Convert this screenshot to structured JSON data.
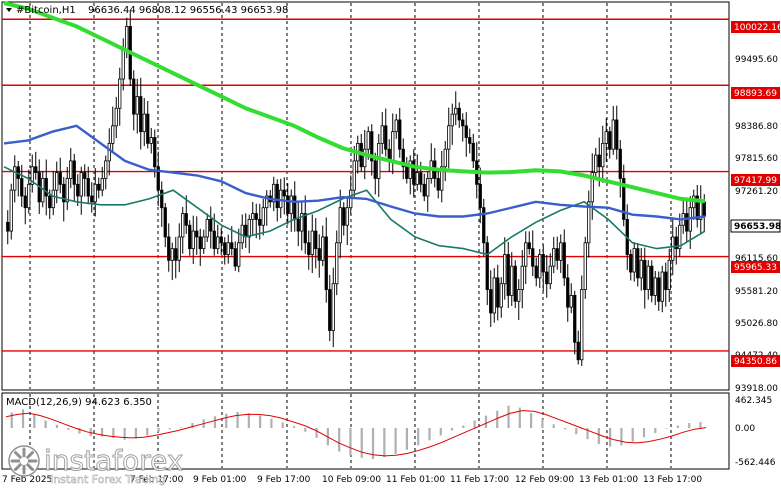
{
  "header": {
    "symbol": "#Bitcoin,H1",
    "ohlc": "96636.44 96808.12 96556.43 96653.98",
    "collapse_icon": "triangle-down-icon"
  },
  "price_axis": {
    "labels": [
      "99495.60",
      "98386.80",
      "97815.60",
      "97261.20",
      "96115.60",
      "95581.20",
      "95026.80",
      "94472.40",
      "93918.00"
    ]
  },
  "levels": [
    {
      "label": "100022.16",
      "color": "#e00000"
    },
    {
      "label": "98893.69",
      "color": "#e00000"
    },
    {
      "label": "97417.99",
      "color": "#e00000"
    },
    {
      "label": "95965.33",
      "color": "#e00000"
    },
    {
      "label": "94350.86",
      "color": "#e00000"
    }
  ],
  "current_price": {
    "label": "96653.98",
    "color": "#ffffff"
  },
  "macd": {
    "label": "MACD(12,26,9) 94.623 6.350",
    "axis_labels": [
      "462.345",
      "0.00",
      "-562.446"
    ]
  },
  "time_axis": {
    "labels": [
      "7 Feb 2025",
      "7 Feb 17:00",
      "9 Feb 01:00",
      "9 Feb 17:00",
      "10 Feb 09:00",
      "11 Feb 01:00",
      "11 Feb 17:00",
      "12 Feb 09:00",
      "13 Feb 01:00",
      "13 Feb 17:00"
    ]
  },
  "watermark": {
    "brand": "instaforex",
    "tagline": "Instant Forex Trading",
    "logo_icon": "instaforex-logo-icon"
  },
  "colors": {
    "bull": "#000000",
    "bear": "#000000",
    "ma_fast": "#1a7a6a",
    "ma_mid": "#3a5fcd",
    "ma_slow": "#33dd33",
    "level_line": "#e00000",
    "grid": "#000000"
  },
  "chart_data": {
    "type": "candlestick",
    "symbol": "#Bitcoin",
    "timeframe": "H1",
    "ylim": [
      93700,
      100300
    ],
    "horizontal_levels": [
      100022.16,
      98893.69,
      97417.99,
      95965.33,
      94350.86
    ],
    "candles_close": [
      96400,
      97100,
      97500,
      97300,
      97000,
      96800,
      97200,
      97500,
      97400,
      96900,
      97300,
      97000,
      96800,
      97100,
      97400,
      97200,
      96900,
      97300,
      97600,
      97200,
      97000,
      97400,
      97300,
      97000,
      96900,
      97200,
      97100,
      97300,
      97600,
      97900,
      98200,
      98500,
      99000,
      99500,
      99900,
      99000,
      98400,
      98700,
      98100,
      98400,
      97900,
      98000,
      97500,
      97100,
      96800,
      96300,
      95900,
      96100,
      95900,
      96300,
      96700,
      96500,
      96100,
      96400,
      96300,
      96100,
      96300,
      96600,
      96400,
      96100,
      96300,
      96200,
      96000,
      96200,
      96100,
      95800,
      96200,
      96500,
      96300,
      96600,
      96700,
      96600,
      96500,
      96800,
      97000,
      96900,
      97200,
      96800,
      97100,
      97000,
      96700,
      97000,
      96600,
      96400,
      96700,
      96200,
      96000,
      96400,
      96100,
      95900,
      96300,
      95400,
      94700,
      95500,
      96200,
      96800,
      96500,
      96800,
      97100,
      97600,
      97900,
      97500,
      97800,
      98100,
      97600,
      97300,
      97900,
      98200,
      97800,
      97600,
      98100,
      98300,
      97800,
      97500,
      97300,
      97600,
      97200,
      97400,
      97200,
      97000,
      97300,
      97600,
      97300,
      97100,
      97500,
      97800,
      98200,
      98400,
      98500,
      98300,
      98200,
      98000,
      97900,
      97600,
      97200,
      96800,
      96200,
      95400,
      95000,
      95600,
      95100,
      95500,
      96000,
      95300,
      95800,
      95200,
      95400,
      95800,
      96200,
      96100,
      95800,
      95600,
      96000,
      95700,
      95500,
      95800,
      96100,
      95900,
      96200,
      95600,
      95100,
      95300,
      94500,
      94200,
      95400,
      96200,
      96900,
      97400,
      97700,
      97500,
      97900,
      98100,
      97800,
      98300,
      97800,
      97300,
      96600,
      96000,
      95700,
      96100,
      95600,
      95900,
      95400,
      95800,
      95300,
      95600,
      95200,
      95700,
      95400,
      95900,
      96300,
      96100,
      96500,
      96700,
      96400,
      96800,
      97000,
      96600,
      96900,
      96654
    ],
    "ma_slow": [
      100300,
      100200,
      100050,
      99900,
      99700,
      99500,
      99300,
      99100,
      98900,
      98700,
      98500,
      98350,
      98200,
      98000,
      97820,
      97700,
      97600,
      97500,
      97450,
      97420,
      97400,
      97410,
      97440,
      97420,
      97350,
      97250,
      97150,
      97050,
      96950,
      96910
    ],
    "ma_mid": [
      97900,
      97950,
      98100,
      98200,
      97900,
      97600,
      97450,
      97400,
      97350,
      97250,
      97050,
      96950,
      96900,
      96920,
      96980,
      96950,
      96820,
      96700,
      96650,
      96650,
      96700,
      96800,
      96900,
      96850,
      96820,
      96800,
      96680,
      96650,
      96600,
      96650
    ],
    "ma_fast": [
      97500,
      97300,
      97000,
      96900,
      96850,
      96850,
      96950,
      97100,
      96800,
      96500,
      96300,
      96400,
      96600,
      96750,
      96950,
      97100,
      96600,
      96300,
      96150,
      96100,
      96000,
      96300,
      96550,
      96750,
      96900,
      96600,
      96200,
      96100,
      96150,
      96400
    ],
    "macd": {
      "hist": [
        250,
        300,
        220,
        120,
        50,
        -30,
        -90,
        -130,
        -140,
        -160,
        -190,
        -170,
        -120,
        -60,
        -20,
        10,
        80,
        140,
        190,
        230,
        260,
        240,
        200,
        150,
        90,
        30,
        -60,
        -160,
        -280,
        -380,
        -440,
        -480,
        -500,
        -470,
        -420,
        -350,
        -280,
        -200,
        -120,
        -40,
        40,
        120,
        200,
        280,
        360,
        330,
        240,
        140,
        60,
        -20,
        -100,
        -180,
        -260,
        -300,
        -280,
        -220,
        -150,
        -80,
        -10,
        40,
        80,
        95
      ],
      "signal": [
        180,
        220,
        240,
        200,
        140,
        70,
        0,
        -60,
        -100,
        -130,
        -150,
        -160,
        -150,
        -120,
        -80,
        -40,
        10,
        60,
        110,
        160,
        200,
        220,
        220,
        200,
        160,
        100,
        40,
        -40,
        -140,
        -240,
        -320,
        -390,
        -430,
        -450,
        -440,
        -410,
        -360,
        -300,
        -230,
        -150,
        -70,
        10,
        90,
        170,
        240,
        280,
        270,
        220,
        150,
        80,
        10,
        -60,
        -130,
        -190,
        -230,
        -240,
        -220,
        -180,
        -130,
        -70,
        -20,
        6
      ]
    },
    "xlabel": "",
    "ylabel": ""
  }
}
